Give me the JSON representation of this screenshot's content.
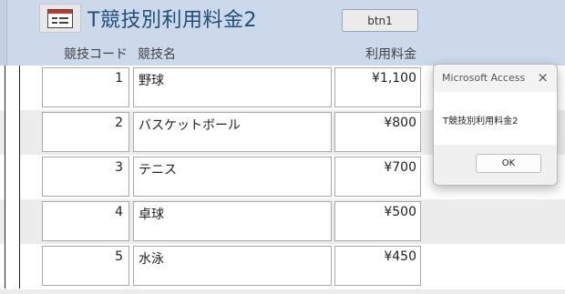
{
  "form": {
    "title": "T競技別利用料金2",
    "button_label": "btn1",
    "headers": {
      "code": "競技コード",
      "name": "競技名",
      "fee": "利用料金"
    }
  },
  "records": [
    {
      "code": "1",
      "name": "野球",
      "fee": "¥1,100"
    },
    {
      "code": "2",
      "name": "バスケットボール",
      "fee": "¥800"
    },
    {
      "code": "3",
      "name": "テニス",
      "fee": "¥700"
    },
    {
      "code": "4",
      "name": "卓球",
      "fee": "¥500"
    },
    {
      "code": "5",
      "name": "水泳",
      "fee": "¥450"
    }
  ],
  "dialog": {
    "title": "Microsoft Access",
    "message": "T競技別利用料金2",
    "ok_label": "OK",
    "close_icon": "×"
  },
  "icons": {
    "form_icon": "form-icon",
    "close": "close-icon"
  }
}
